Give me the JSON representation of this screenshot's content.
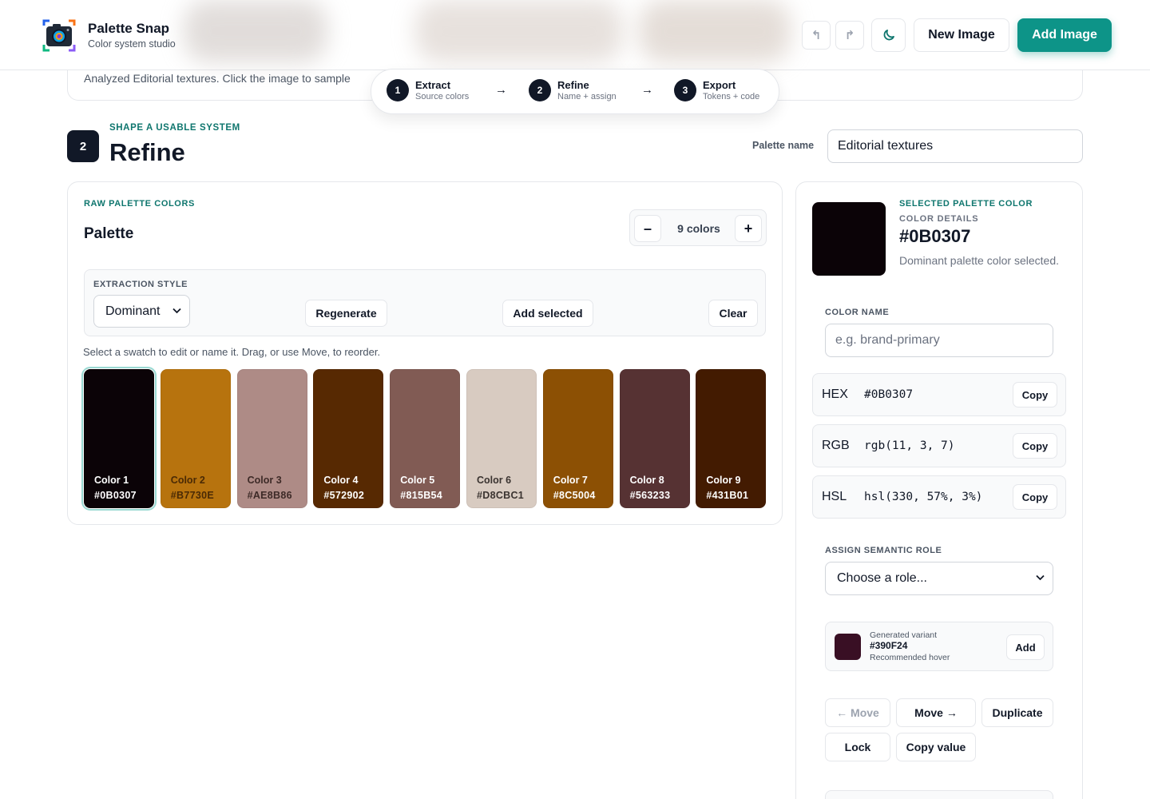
{
  "app": {
    "title": "Palette Snap",
    "subtitle": "Color system studio"
  },
  "header": {
    "undo_icon": "undo-icon",
    "redo_icon": "redo-icon",
    "theme_icon": "moon-icon",
    "new_image_label": "New Image",
    "add_image_label": "Add Image",
    "accent": "#0d9488"
  },
  "info": {
    "text": "Analyzed Editorial textures. Click the image to sample"
  },
  "stepper": {
    "steps": [
      {
        "num": "1",
        "title": "Extract",
        "sub": "Source colors"
      },
      {
        "num": "2",
        "title": "Refine",
        "sub": "Name + assign"
      },
      {
        "num": "3",
        "title": "Export",
        "sub": "Tokens + code"
      }
    ],
    "arrow": "→"
  },
  "section": {
    "num": "2",
    "eyebrow": "SHAPE A USABLE SYSTEM",
    "title": "Refine",
    "palette_name_label": "Palette name",
    "palette_name_value": "Editorial textures"
  },
  "palette": {
    "eyebrow": "RAW PALETTE COLORS",
    "title": "Palette",
    "count_label": "9 colors",
    "minus": "–",
    "plus": "+",
    "extraction_label": "EXTRACTION STYLE",
    "extraction_value": "Dominant",
    "regenerate_label": "Regenerate",
    "add_selected_label": "Add selected",
    "clear_label": "Clear",
    "hint": "Select a swatch to edit or name it. Drag, or use Move, to reorder.",
    "swatches": [
      {
        "name": "Color 1",
        "hex": "#0B0307",
        "color": "#0B0307",
        "text": "#ffffff"
      },
      {
        "name": "Color 2",
        "hex": "#B7730E",
        "color": "#B7730E",
        "text": "#4a2a05"
      },
      {
        "name": "Color 3",
        "hex": "#AE8B86",
        "color": "#AE8B86",
        "text": "#3d2a27"
      },
      {
        "name": "Color 4",
        "hex": "#572902",
        "color": "#572902",
        "text": "#ffffff"
      },
      {
        "name": "Color 5",
        "hex": "#815B54",
        "color": "#815B54",
        "text": "#ffffff"
      },
      {
        "name": "Color 6",
        "hex": "#D8CBC1",
        "color": "#D8CBC1",
        "text": "#3a3330"
      },
      {
        "name": "Color 7",
        "hex": "#8C5004",
        "color": "#8C5004",
        "text": "#ffffff"
      },
      {
        "name": "Color 8",
        "hex": "#563233",
        "color": "#563233",
        "text": "#ffffff"
      },
      {
        "name": "Color 9",
        "hex": "#431B01",
        "color": "#431B01",
        "text": "#ffffff"
      }
    ]
  },
  "details": {
    "eyebrow": "SELECTED PALETTE COLOR",
    "sub": "COLOR DETAILS",
    "hex": "#0B0307",
    "color": "#0B0307",
    "description": "Dominant palette color selected.",
    "color_name_label": "COLOR NAME",
    "color_name_placeholder": "e.g. brand-primary",
    "values": [
      {
        "key": "HEX",
        "value": "#0B0307",
        "copy": "Copy"
      },
      {
        "key": "RGB",
        "value": "rgb(11, 3, 7)",
        "copy": "Copy"
      },
      {
        "key": "HSL",
        "value": "hsl(330, 57%, 3%)",
        "copy": "Copy"
      }
    ],
    "role_label": "ASSIGN SEMANTIC ROLE",
    "role_value": "Choose a role...",
    "variant": {
      "label": "Generated variant",
      "hex": "#390F24",
      "color": "#390F24",
      "note": "Recommended hover",
      "add_label": "Add"
    },
    "actions": {
      "move_left": "← Move",
      "move_right": "Move →",
      "duplicate": "Duplicate",
      "lock": "Lock",
      "copy_value": "Copy value"
    }
  }
}
